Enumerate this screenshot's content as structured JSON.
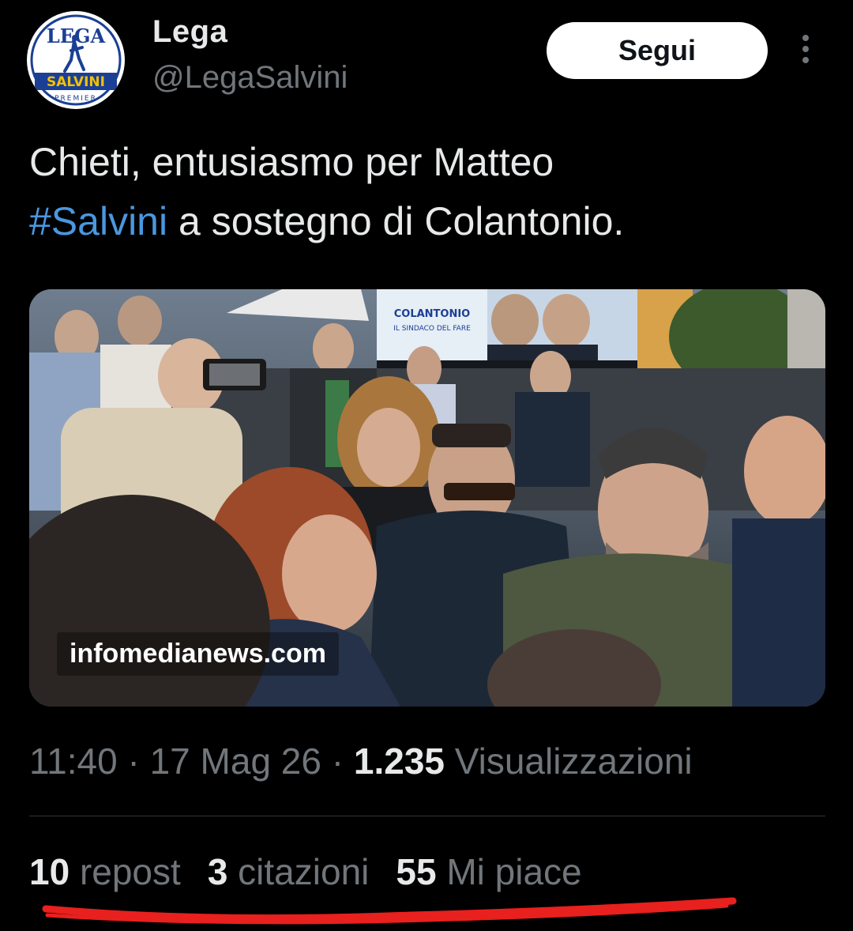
{
  "header": {
    "display_name": "Lega",
    "handle": "@LegaSalvini",
    "follow_label": "Segui",
    "avatar": {
      "logo_text_top": "LEGA",
      "logo_text_banner": "SALVINI",
      "logo_text_bottom": "PREMIER",
      "colors": {
        "blue": "#1b3f94",
        "yellow": "#f2c100",
        "red": "#d2232a"
      }
    },
    "more_icon": "more-vertical-icon"
  },
  "tweet": {
    "text_before": "Chieti, entusiasmo per Matteo",
    "hashtag": "#Salvini",
    "text_after": " a sostegno di Colantonio."
  },
  "media": {
    "watermark": "infomedianews.com",
    "banner_text_1": "COLANTONIO",
    "banner_text_2": "IL SINDACO DEL FARE"
  },
  "meta": {
    "time": "11:40",
    "sep1": " · ",
    "date": "17 Mag 26",
    "sep2": " · ",
    "views_count": "1.235",
    "views_label": " Visualizzazioni"
  },
  "stats": {
    "repost_count": "10",
    "repost_label": " repost",
    "quotes_count": "3",
    "quotes_label": " citazioni",
    "likes_count": "55",
    "likes_label": " Mi piace"
  },
  "colors": {
    "background": "#000000",
    "text_primary": "#e7e9ea",
    "text_secondary": "#71767b",
    "link": "#4a97e0",
    "annotation_red": "#e8201e"
  }
}
